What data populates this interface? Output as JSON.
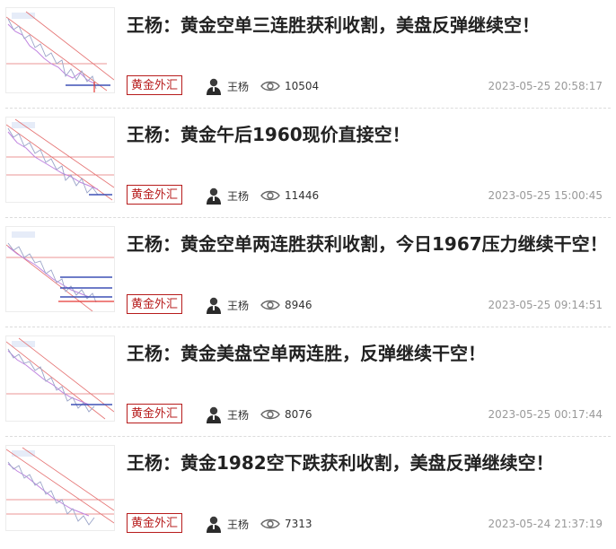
{
  "articles": [
    {
      "title": "王杨：黄金空单三连胜获利收割，美盘反弹继续空！",
      "tag": "黄金外汇",
      "author": "王杨",
      "views": "10504",
      "date": "2023-05-25 20:58:17"
    },
    {
      "title": "王杨：黄金午后1960现价直接空！",
      "tag": "黄金外汇",
      "author": "王杨",
      "views": "11446",
      "date": "2023-05-25 15:00:45"
    },
    {
      "title": "王杨：黄金空单两连胜获利收割，今日1967压力继续干空！",
      "tag": "黄金外汇",
      "author": "王杨",
      "views": "8946",
      "date": "2023-05-25 09:14:51"
    },
    {
      "title": "王杨：黄金美盘空单两连胜，反弹继续干空！",
      "tag": "黄金外汇",
      "author": "王杨",
      "views": "8076",
      "date": "2023-05-25 00:17:44"
    },
    {
      "title": "王杨：黄金1982空下跌获利收割，美盘反弹继续空！",
      "tag": "黄金外汇",
      "author": "王杨",
      "views": "7313",
      "date": "2023-05-24 21:37:19"
    }
  ],
  "colors": {
    "tag": "#b71c1c",
    "title": "#222222",
    "meta": "#999999"
  }
}
